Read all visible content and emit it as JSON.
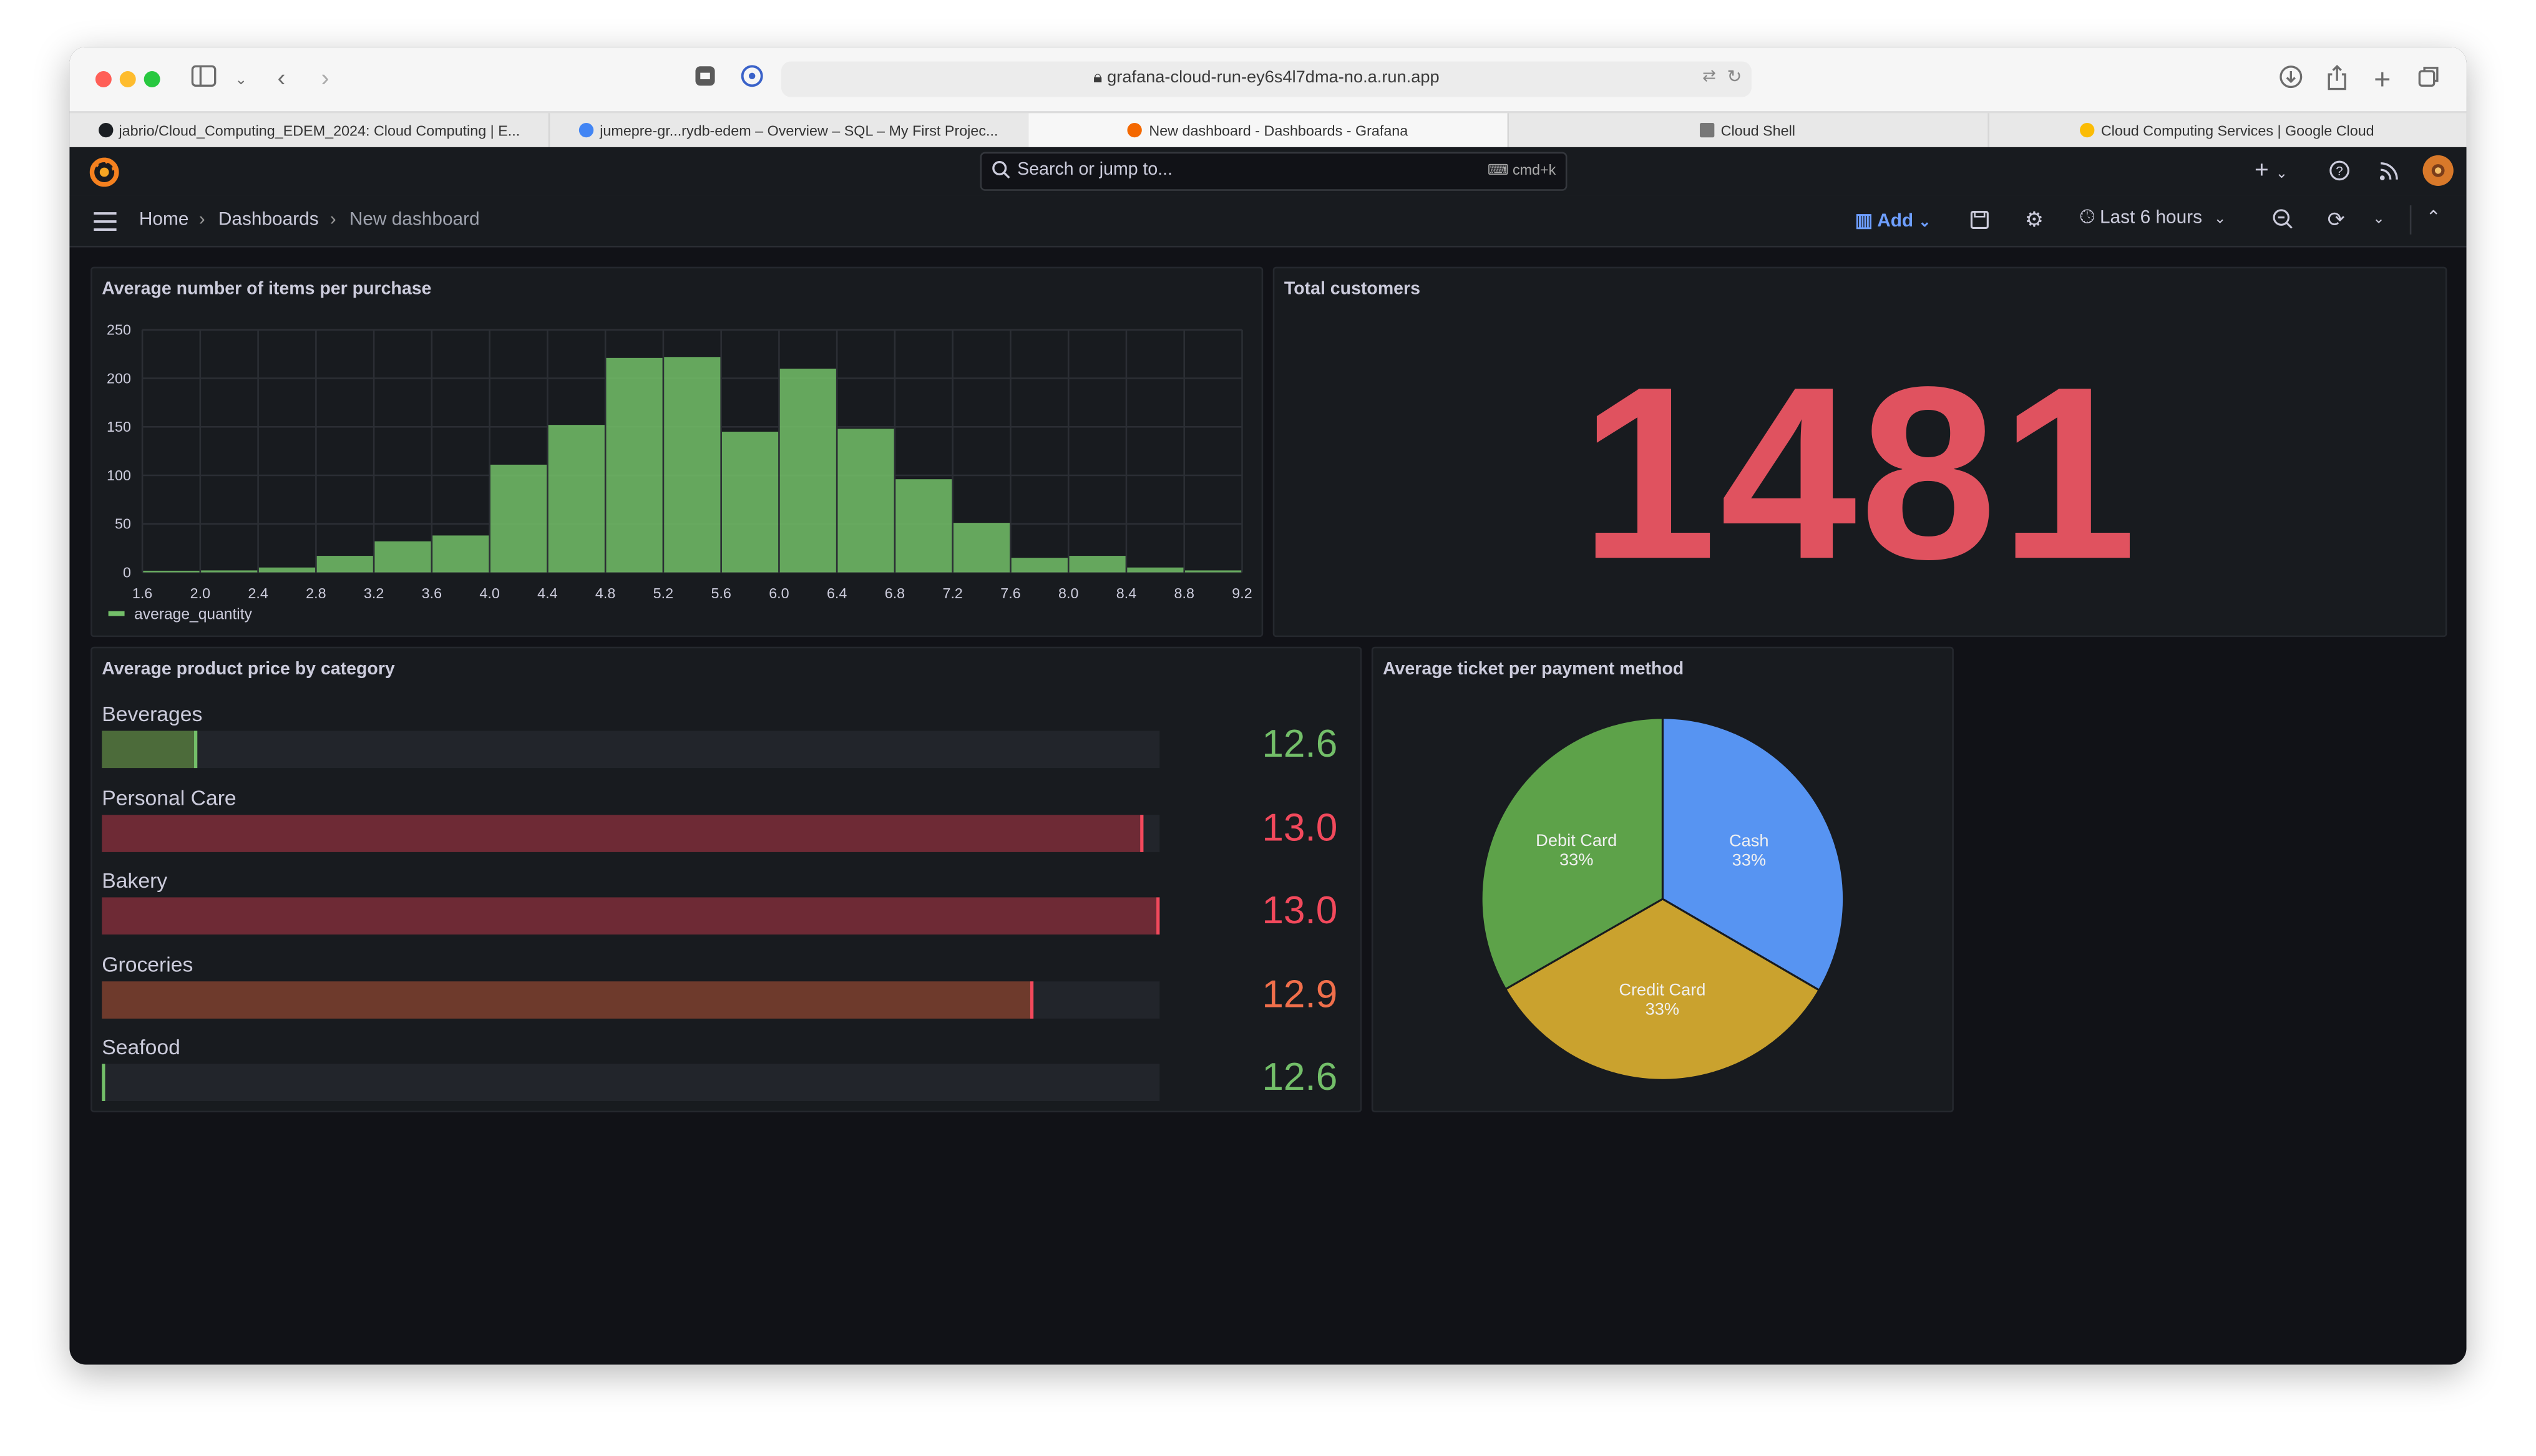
{
  "browser": {
    "url": "grafana-cloud-run-ey6s4l7dma-no.a.run.app",
    "tabs": [
      {
        "label": "jabrio/Cloud_Computing_EDEM_2024: Cloud Computing | E...",
        "fav_color": "#1b1f23"
      },
      {
        "label": "jumepre-gr...rydb-edem – Overview – SQL – My First Projec...",
        "fav_color": "#4285f4"
      },
      {
        "label": "New dashboard - Dashboards - Grafana",
        "fav_color": "#f46800"
      },
      {
        "label": "Cloud Shell",
        "fav_color": "#777777"
      },
      {
        "label": "Cloud Computing Services | Google Cloud",
        "fav_color": "#fbbc05"
      }
    ]
  },
  "grafana": {
    "search_placeholder": "Search or jump to...",
    "search_shortcut": "cmd+k",
    "breadcrumb": [
      "Home",
      "Dashboards",
      "New dashboard"
    ],
    "add_label": "Add",
    "time_range": "Last 6 hours"
  },
  "panels": {
    "histogram": {
      "title": "Average number of items per purchase"
    },
    "stat": {
      "title": "Total customers",
      "value": "1481"
    },
    "bargauge": {
      "title": "Average product price by category",
      "items": [
        {
          "label": "Beverages",
          "value": "12.6",
          "fraction": 0.09,
          "fill": "#4c6b3a",
          "edge": "#73bf69",
          "color": "#73bf69"
        },
        {
          "label": "Personal Care",
          "value": "13.0",
          "fraction": 0.985,
          "fill": "#6e2a35",
          "edge": "#f2495c",
          "color": "#f2495c"
        },
        {
          "label": "Bakery",
          "value": "13.0",
          "fraction": 1.0,
          "fill": "#6e2a35",
          "edge": "#f2495c",
          "color": "#f2495c"
        },
        {
          "label": "Groceries",
          "value": "12.9",
          "fraction": 0.88,
          "fill": "#6e3a2c",
          "edge": "#f2495c",
          "color": "#f06f4b"
        },
        {
          "label": "Seafood",
          "value": "12.6",
          "fraction": 0.0,
          "fill": "#4c6b3a",
          "edge": "#73bf69",
          "color": "#73bf69"
        }
      ]
    },
    "pie": {
      "title": "Average ticket per payment method"
    }
  },
  "chart_data": [
    {
      "type": "bar",
      "title": "Average number of items per purchase",
      "x_ticks": [
        "1.6",
        "2.0",
        "2.4",
        "2.8",
        "3.2",
        "3.6",
        "4.0",
        "4.4",
        "4.8",
        "5.2",
        "5.6",
        "6.0",
        "6.4",
        "6.8",
        "7.2",
        "7.6",
        "8.0",
        "8.4",
        "8.8",
        "9.2"
      ],
      "bin_edges": [
        1.6,
        2.0,
        2.4,
        2.8,
        3.2,
        3.6,
        4.0,
        4.4,
        4.8,
        5.2,
        5.6,
        6.0,
        6.4,
        6.8,
        7.2,
        7.6,
        8.0,
        8.4,
        8.8,
        9.2
      ],
      "values": [
        1,
        2,
        5,
        17,
        32,
        38,
        111,
        152,
        221,
        222,
        145,
        210,
        148,
        96,
        51,
        15,
        17,
        5,
        2
      ],
      "ylim": [
        0,
        250
      ],
      "y_ticks": [
        "0",
        "50",
        "100",
        "150",
        "200",
        "250"
      ],
      "series": [
        {
          "name": "average_quantity",
          "color": "#73bf69"
        }
      ],
      "legend": "bottom-left",
      "grid": true
    },
    {
      "type": "pie",
      "title": "Average ticket per payment method",
      "slices": [
        {
          "label": "Cash",
          "pct_label": "33%",
          "value": 33.4,
          "color": "#5794f2"
        },
        {
          "label": "Credit Card",
          "pct_label": "33%",
          "value": 33.3,
          "color": "#caa22e"
        },
        {
          "label": "Debit Card",
          "pct_label": "33%",
          "value": 33.3,
          "color": "#5da249"
        }
      ]
    }
  ]
}
